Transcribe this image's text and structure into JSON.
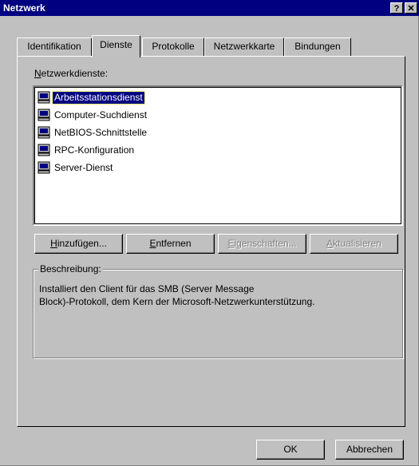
{
  "window": {
    "title": "Netzwerk",
    "help_button": "?",
    "close_button": "✕"
  },
  "tabs": [
    {
      "label": "Identifikation",
      "active": false
    },
    {
      "label": "Dienste",
      "active": true
    },
    {
      "label": "Protokolle",
      "active": false
    },
    {
      "label": "Netzwerkkarte",
      "active": false
    },
    {
      "label": "Bindungen",
      "active": false
    }
  ],
  "services": {
    "label_mnemonic": "N",
    "label_rest": "etzwerkdienste:",
    "items": [
      {
        "label": "Arbeitsstationsdienst",
        "selected": true,
        "icon": "computer-icon"
      },
      {
        "label": "Computer-Suchdienst",
        "selected": false,
        "icon": "computer-icon"
      },
      {
        "label": "NetBIOS-Schnittstelle",
        "selected": false,
        "icon": "computer-icon"
      },
      {
        "label": "RPC-Konfiguration",
        "selected": false,
        "icon": "computer-icon"
      },
      {
        "label": "Server-Dienst",
        "selected": false,
        "icon": "computer-icon"
      }
    ]
  },
  "buttons": {
    "add": {
      "mnemonic": "H",
      "rest": "inzufügen...",
      "enabled": true
    },
    "remove": {
      "mnemonic": "E",
      "rest": "ntfernen",
      "enabled": true
    },
    "properties": {
      "mnemonic": "E",
      "rest": "igenschaften...",
      "enabled": false
    },
    "update": {
      "mnemonic": "A",
      "rest": "ktualisieren",
      "enabled": false
    }
  },
  "description": {
    "title": "Beschreibung:",
    "line1": "Installiert den Client für das SMB (Server Message",
    "line2": "Block)-Protokoll, dem Kern der Microsoft-Netzwerkunterstützung."
  },
  "footer": {
    "ok": "OK",
    "cancel": "Abbrechen"
  },
  "colors": {
    "titlebar": "#000080",
    "face": "#c0c0c0",
    "selection": "#000080"
  }
}
